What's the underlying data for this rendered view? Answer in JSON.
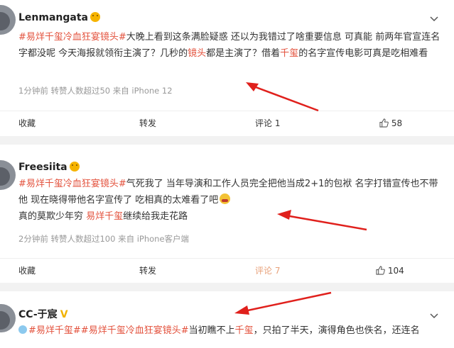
{
  "posts": [
    {
      "username": "Lenmangata",
      "text_parts": [
        {
          "t": "#易烊千玺冷血狂宴镜头#",
          "c": "tag"
        },
        {
          "t": "大晚上看到这条满脸疑惑 还以为我错过了啥重要信息 可真能 前两年官宣连名字都没呢 今天海报就领衔主演了？几秒的",
          "c": ""
        },
        {
          "t": "镜头",
          "c": "hl"
        },
        {
          "t": "都是主演了？借着",
          "c": ""
        },
        {
          "t": "千玺",
          "c": "hl"
        },
        {
          "t": "的名字宣传电影可真是吃相难看",
          "c": ""
        }
      ],
      "meta": "1分钟前 转赞人数超过50  来自 iPhone 12",
      "actions": {
        "collect": "收藏",
        "repost": "转发",
        "comment": "评论 1",
        "like": "58"
      }
    },
    {
      "username": "Freesiita",
      "text_parts": [
        {
          "t": "#易烊千玺冷血狂宴镜头#",
          "c": "tag"
        },
        {
          "t": "气死我了 当年导演和工作人员完全把他当成2+1的包袱 名字打错宣传也不带他 现在晓得带他名字宣传了 吃相真的太难看了吧",
          "c": ""
        }
      ],
      "second_line_parts": [
        {
          "t": "真的莫欺少年穷 ",
          "c": ""
        },
        {
          "t": "易烊千玺",
          "c": "hl"
        },
        {
          "t": "继续给我走花路",
          "c": ""
        }
      ],
      "meta": "2分钟前 转赞人数超过100  来自 iPhone客户端",
      "actions": {
        "collect": "收藏",
        "repost": "转发",
        "comment": "评论 7",
        "like": "104"
      }
    },
    {
      "username": "CC-于宸",
      "text_parts": [
        {
          "t": "#易烊千玺#",
          "c": "tag"
        },
        {
          "t": "#易烊千玺冷血狂宴镜头#",
          "c": "tag"
        },
        {
          "t": "当初瞧不上",
          "c": ""
        },
        {
          "t": "千玺",
          "c": "hl"
        },
        {
          "t": "，只拍了半天，演得角色也佚名，还连名",
          "c": ""
        }
      ]
    }
  ],
  "colors": {
    "accent": "#e3513c",
    "arrow": "#e0201c",
    "comment_active": "#e8a17a"
  }
}
